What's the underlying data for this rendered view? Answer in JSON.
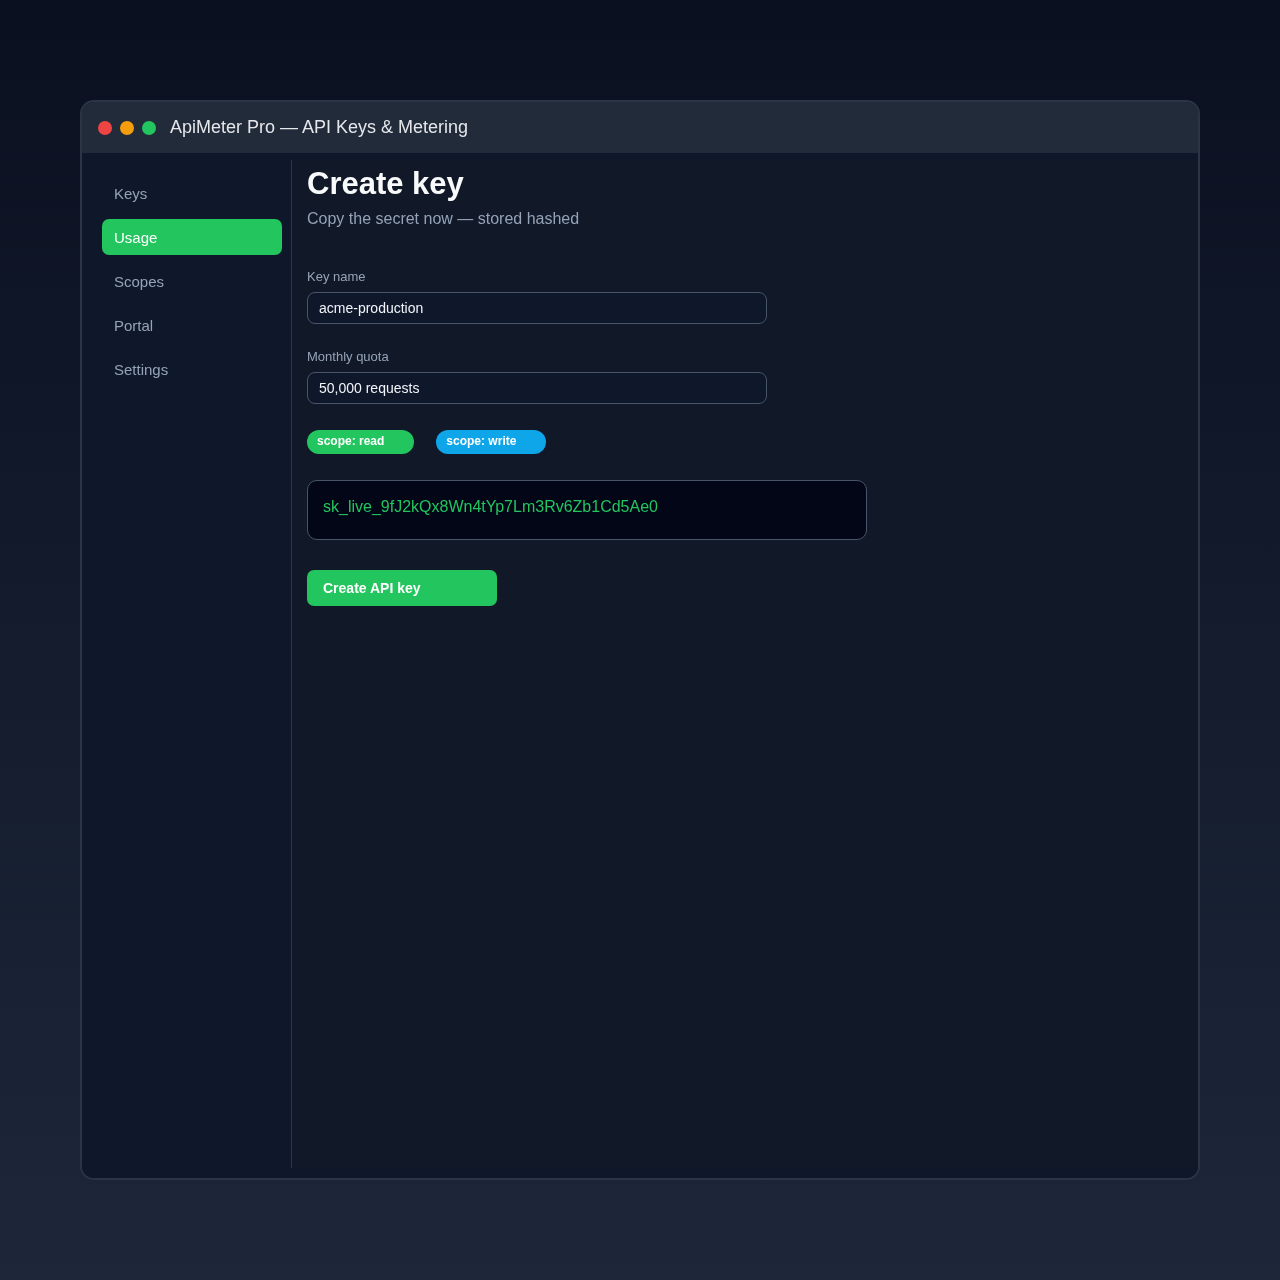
{
  "window": {
    "title": "ApiMeter Pro — API Keys & Metering"
  },
  "sidebar": {
    "items": [
      {
        "label": "Keys",
        "selected": false
      },
      {
        "label": "Usage",
        "selected": true
      },
      {
        "label": "Scopes",
        "selected": false
      },
      {
        "label": "Portal",
        "selected": false
      },
      {
        "label": "Settings",
        "selected": false
      }
    ]
  },
  "main": {
    "title": "Create key",
    "subtitle": "Copy the secret now — stored hashed",
    "fields": [
      {
        "label": "Key name",
        "value": "acme-production"
      },
      {
        "label": "Monthly quota",
        "value": "50,000 requests"
      }
    ],
    "scopes": [
      {
        "label": "scope: read",
        "color": "#22c55e"
      },
      {
        "label": "scope: write",
        "color": "#0ea5e9"
      }
    ],
    "secret": "sk_live_9fJ2kQx8Wn4tYp7Lm3Rv6Zb1Cd5Ae0",
    "button": "Create API key"
  }
}
